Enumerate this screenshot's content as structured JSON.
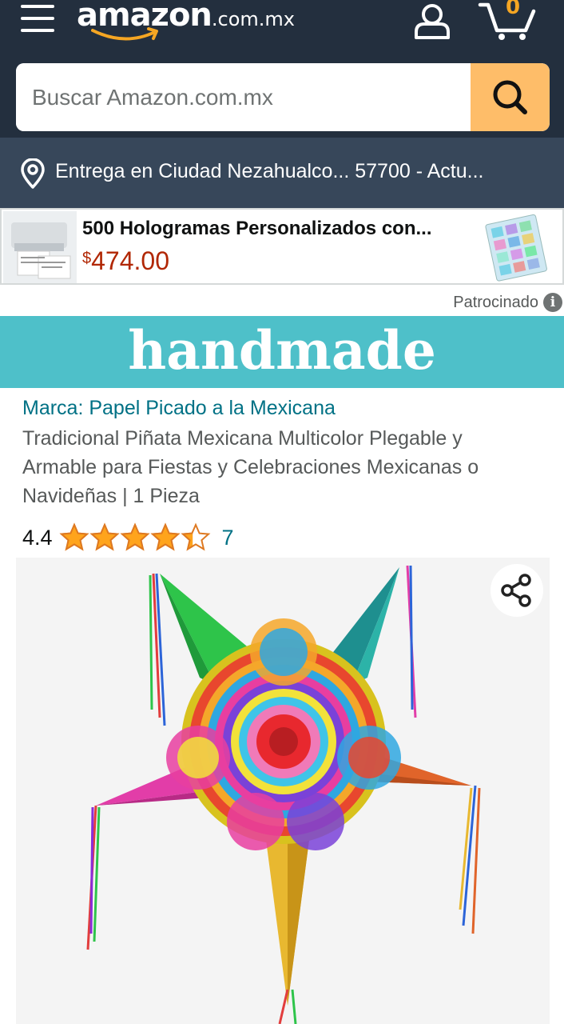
{
  "header": {
    "logo_word": "amazon",
    "logo_domain": ".com.mx",
    "cart_count": "0",
    "icons": {
      "menu": "hamburger-menu-icon",
      "user": "user-account-icon",
      "cart": "shopping-cart-icon",
      "search": "search-icon"
    },
    "colors": {
      "bar": "#232f3e",
      "accent": "#febd69",
      "cart_count": "#f5a623"
    }
  },
  "search": {
    "placeholder": "Buscar Amazon.com.mx",
    "value": ""
  },
  "delivery": {
    "icon": "location-pin-icon",
    "text": "Entrega en Ciudad Nezahualco... 57700 - Actu..."
  },
  "sponsored_ad": {
    "title": "500 Hologramas Personalizados con...",
    "price_currency": "$",
    "price_amount": "474.00",
    "label": "Patrocinado",
    "info_icon": "i"
  },
  "banner": {
    "text": "handmade",
    "color": "#4ec0c9"
  },
  "product": {
    "brand": "Marca: Papel Picado a la Mexicana",
    "title": "Tradicional Piñata Mexicana Multicolor Plegable y Armable para Fiestas y Celebraciones Mexicanas o Navideñas | 1 Pieza",
    "rating_value": "4.4",
    "rating_stars": 4.4,
    "rating_count": "7",
    "share_icon": "share-icon",
    "image_subject": "star-pinata-image"
  }
}
